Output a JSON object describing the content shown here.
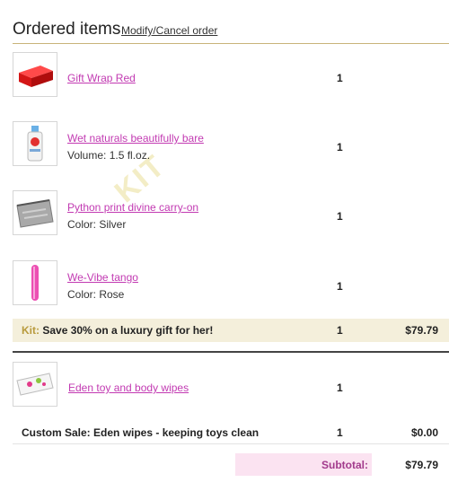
{
  "header": {
    "title": "Ordered items",
    "modify_link": "Modify/Cancel order"
  },
  "watermark": "KIT",
  "items": [
    {
      "name": "Gift Wrap Red",
      "attribute": "",
      "qty": "1",
      "icon": "gift-box-icon",
      "color": "#e02020"
    },
    {
      "name": "Wet naturals beautifully bare",
      "attribute": "Volume: 1.5 fl.oz.",
      "qty": "1",
      "icon": "bottle-icon"
    },
    {
      "name": "Python print divine carry-on",
      "attribute": "Color: Silver",
      "qty": "1",
      "icon": "pouch-icon"
    },
    {
      "name": "We-Vibe tango",
      "attribute": "Color: Rose",
      "qty": "1",
      "icon": "vibe-icon",
      "color": "#ec4fb3"
    }
  ],
  "kit": {
    "label": "Kit:",
    "text": "Save 30% on a luxury gift for her!",
    "qty": "1",
    "price": "$79.79"
  },
  "extra_item": {
    "name": "Eden toy and body wipes",
    "qty": "1",
    "icon": "wipes-icon"
  },
  "custom_sale": {
    "text": "Custom Sale: Eden wipes - keeping toys clean",
    "qty": "1",
    "price": "$0.00"
  },
  "subtotal": {
    "label": "Subtotal:",
    "value": "$79.79"
  },
  "colors": {
    "link": "#c23ab2",
    "accent_line": "#c9b37a",
    "kit_bg": "#f4efdb",
    "subtotal_bg": "#fbe3f1"
  }
}
